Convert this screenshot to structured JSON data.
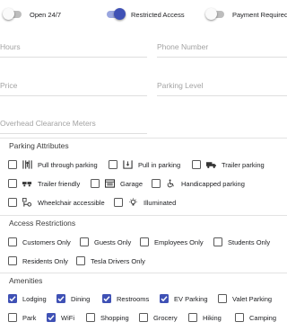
{
  "toggles": [
    {
      "label": "Open 24/7",
      "on": false
    },
    {
      "label": "Restricted Access",
      "on": true
    },
    {
      "label": "Payment Required",
      "on": false
    }
  ],
  "fields": {
    "hours_placeholder": "Hours",
    "phone_placeholder": "Phone Number",
    "price_placeholder": "Price",
    "parking_level_placeholder": "Parking Level",
    "clearance_placeholder": "Overhead Clearance Meters"
  },
  "parking_attributes": {
    "title": "Parking Attributes",
    "items": [
      {
        "label": "Pull through parking",
        "icon": "pull-through-icon",
        "checked": false
      },
      {
        "label": "Pull in parking",
        "icon": "pull-in-icon",
        "checked": false
      },
      {
        "label": "Trailer parking",
        "icon": "truck-icon",
        "checked": false
      },
      {
        "label": "Trailer friendly",
        "icon": "trailer-icon",
        "checked": false
      },
      {
        "label": "Garage",
        "icon": "garage-icon",
        "checked": false
      },
      {
        "label": "Handicapped parking",
        "icon": "wheelchair-icon",
        "checked": false
      },
      {
        "label": "Wheelchair accessible",
        "icon": "wheelchair-accessible-icon",
        "checked": false
      },
      {
        "label": "Illuminated",
        "icon": "lightbulb-icon",
        "checked": false
      }
    ]
  },
  "access_restrictions": {
    "title": "Access Restrictions",
    "items": [
      {
        "label": "Customers Only",
        "checked": false
      },
      {
        "label": "Guests Only",
        "checked": false
      },
      {
        "label": "Employees Only",
        "checked": false
      },
      {
        "label": "Students Only",
        "checked": false
      },
      {
        "label": "Residents Only",
        "checked": false
      },
      {
        "label": "Tesla Drivers Only",
        "checked": false
      }
    ]
  },
  "amenities": {
    "title": "Amenities",
    "items": [
      {
        "label": "Lodging",
        "checked": true
      },
      {
        "label": "Dining",
        "checked": true
      },
      {
        "label": "Restrooms",
        "checked": true
      },
      {
        "label": "EV Parking",
        "checked": true
      },
      {
        "label": "Valet Parking",
        "checked": false
      },
      {
        "label": "Park",
        "checked": false
      },
      {
        "label": "WiFi",
        "checked": true
      },
      {
        "label": "Shopping",
        "checked": false
      },
      {
        "label": "Grocery",
        "checked": false
      },
      {
        "label": "Hiking",
        "checked": false
      },
      {
        "label": "Camping",
        "checked": false
      }
    ]
  },
  "colors": {
    "accent": "#3f51b5",
    "track_on": "#9aa6df",
    "track_off": "#bdbdbd"
  }
}
